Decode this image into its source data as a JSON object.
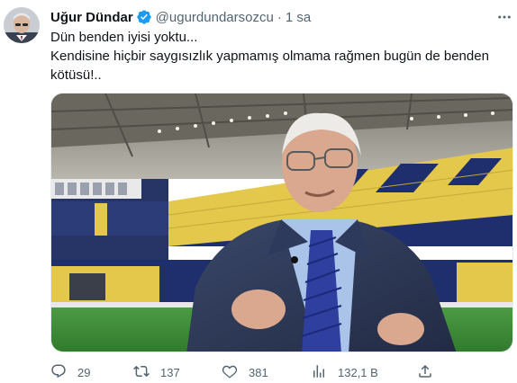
{
  "author": {
    "name": "Uğur Dündar",
    "handle": "@ugurdundarsozcu",
    "separator": "·",
    "time": "1 sa"
  },
  "tweet": {
    "lines": [
      "Dün benden iyisi yoktu...",
      "Kendisine hiçbir saygısızlık yapmamış olmama rağmen bugün de benden kötüsü!.."
    ]
  },
  "actions": {
    "replies": "29",
    "retweets": "137",
    "likes": "381",
    "views": "132,1 B"
  },
  "colors": {
    "verified": "#1d9bf0",
    "secondary_text": "#536471",
    "stadium_seat_yellow": "#e4c84b",
    "stadium_seat_navy": "#1f2f6e",
    "pitch_green": "#3f8a3a"
  },
  "icons": [
    "verified-badge-icon",
    "more-icon",
    "reply-icon",
    "retweet-icon",
    "like-icon",
    "views-icon",
    "share-icon"
  ]
}
